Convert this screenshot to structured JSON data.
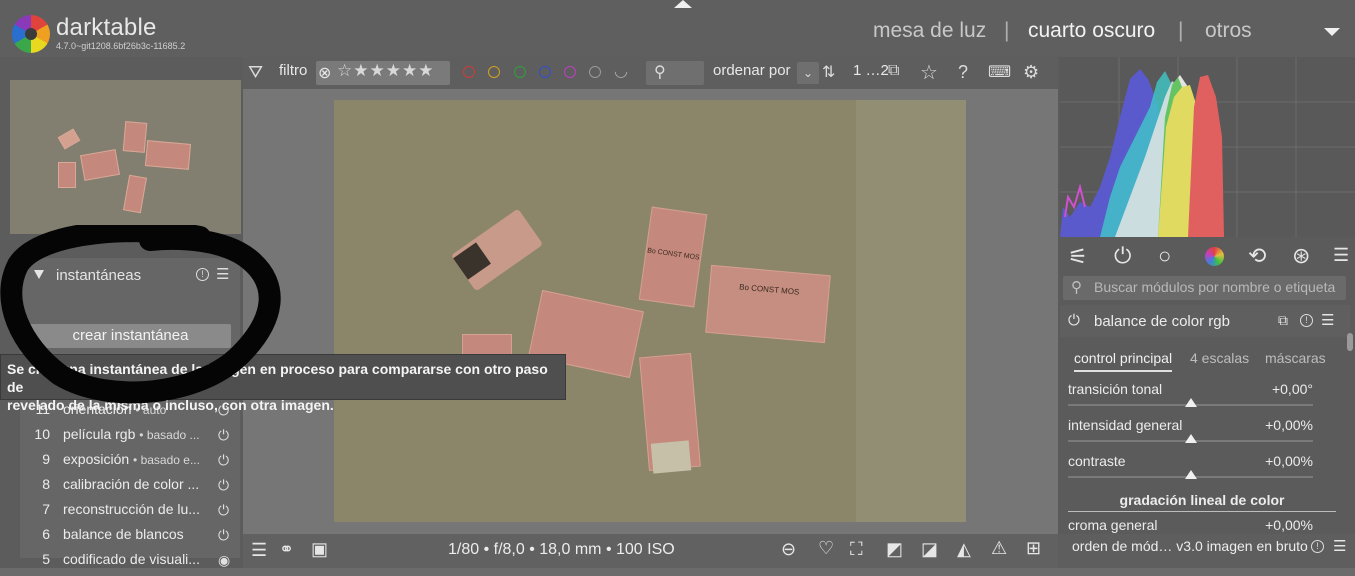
{
  "header": {
    "app_name": "darktable",
    "version": "4.7.0~git1208.6bf26b3c-11685.2",
    "views": [
      "mesa de luz",
      "cuarto oscuro",
      "otros"
    ],
    "separator": "|"
  },
  "toolbar": {
    "filter_label": "filtro",
    "sort_label": "ordenar por",
    "grid_count": "1 …2",
    "stars_glyphs": "☆★★★★★",
    "color_labels": [
      "#d23a3a",
      "#d4a020",
      "#30a040",
      "#3050d0",
      "#c040c0",
      "#9a9a9a"
    ]
  },
  "left_panel": {
    "snapshots": {
      "title": "instantáneas",
      "button_label": "crear instantánea"
    },
    "history": [
      {
        "num": "11",
        "name": "orientación",
        "sub": "• auto"
      },
      {
        "num": "10",
        "name": "película rgb",
        "sub": "• basado ..."
      },
      {
        "num": "9",
        "name": "exposición",
        "sub": "• basado e..."
      },
      {
        "num": "8",
        "name": "calibración de color ...",
        "sub": ""
      },
      {
        "num": "7",
        "name": "reconstrucción de lu...",
        "sub": ""
      },
      {
        "num": "6",
        "name": "balance de blancos",
        "sub": ""
      },
      {
        "num": "5",
        "name": "codificado de visuali...",
        "sub": ""
      }
    ]
  },
  "tooltip": {
    "line1": "Se crea una instantánea de la imagen en proceso para compararse con otro paso de",
    "line2": "revelado de la misma o incluso, con otra imagen."
  },
  "photo_text": {
    "card1": "Bo CONST MOS",
    "card2": "Bo CONST MOS"
  },
  "bottom_bar": {
    "exif": "1/80 • f/8,0 • 18,0 mm • 100 ISO"
  },
  "right_panel": {
    "search_placeholder": "Buscar módulos por nombre o etiqueta",
    "module": {
      "title": "balance de color rgb",
      "tabs": [
        "control principal",
        "4 escalas",
        "máscaras"
      ],
      "sliders": [
        {
          "label": "transición tonal",
          "value": "+0,00°"
        },
        {
          "label": "intensidad general",
          "value": "+0,00%"
        },
        {
          "label": "contraste",
          "value": "+0,00%"
        }
      ],
      "section_title": "gradación lineal de color",
      "partial_slider": {
        "label": "croma general",
        "value": "+0,00%"
      }
    },
    "bottom": {
      "order_label": "orden de mód…",
      "order_value": "v3.0 imagen en bruto"
    }
  }
}
